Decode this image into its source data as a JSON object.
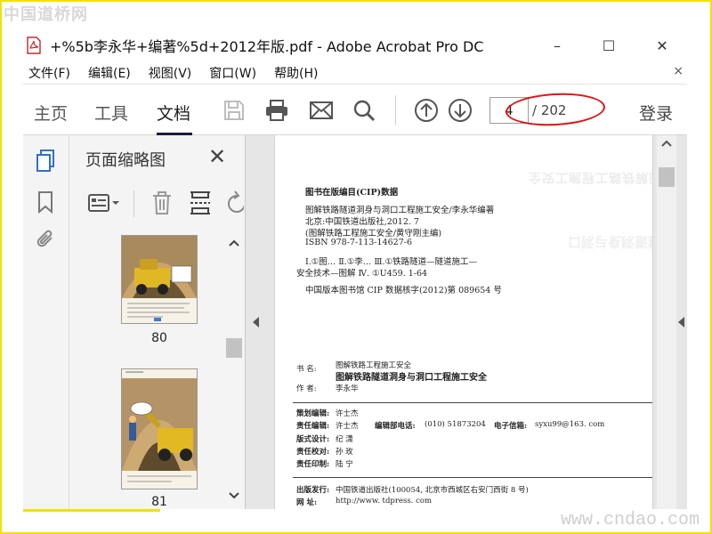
{
  "watermarks": {
    "top": "中国道桥网",
    "bottom": "www.cndao.com"
  },
  "window": {
    "title": "+%5b李永华+编著%5d+2012年版.pdf - Adobe Acrobat Pro DC",
    "controls": {
      "minimize": "–",
      "maximize": "☐",
      "close": "✕"
    }
  },
  "menu": {
    "items": [
      "文件(F)",
      "编辑(E)",
      "视图(V)",
      "窗口(W)",
      "帮助(H)"
    ],
    "close": "×"
  },
  "toolbar": {
    "tabs": [
      "主页",
      "工具",
      "文档"
    ],
    "active_tab": "文档",
    "page_number": "4",
    "page_total": "/ 202",
    "login": "登录",
    "icons": [
      "save-icon",
      "print-icon",
      "mail-icon",
      "search-icon",
      "page-up-icon",
      "page-down-icon"
    ]
  },
  "thumbnail_panel": {
    "title": "页面缩略图",
    "close": "✕",
    "pages": [
      {
        "label": "80"
      },
      {
        "label": "81"
      }
    ]
  },
  "document": {
    "cip_heading": "图书在版编目(CIP)数据",
    "cip_lines": [
      "图解铁路隧道洞身与洞口工程施工安全/李永华编著",
      "北京:中国铁道出版社,2012. 7",
      "(图解铁路工程施工安全/黄守刚主编)",
      "ISBN 978-7-113-14627-6"
    ],
    "classification_lines": [
      "Ⅰ.①图…  Ⅱ.①李…  Ⅲ.①铁路隧道—隧道施工—",
      "安全技术—图解  Ⅳ. ①U459. 1-64"
    ],
    "cip_record": "中国版本图书馆 CIP 数据核字(2012)第 089654 号",
    "book_label": "书    名:",
    "series_name": "图解铁路工程施工安全",
    "book_title": "图解铁路隧道洞身与洞口工程施工安全",
    "author_label": "作    者:",
    "author": "李永华",
    "planning_editor_label": "策划编辑:",
    "planning_editor": "许士杰",
    "responsible_editor_label": "责任编辑:",
    "responsible_editor": "许士杰",
    "editor_phone_label": "编辑部电话:",
    "editor_phone": "(010) 51873204",
    "email_label": "电子信箱:",
    "email": "syxu99@163. com",
    "design_label": "版式设计:",
    "design": "纪  潇",
    "proof_label": "责任校对:",
    "proof": "孙  玫",
    "print_label": "责任印制:",
    "print": "陆  宁",
    "publisher_label": "出版发行:",
    "publisher": "中国铁道出版社(100054, 北京市西城区右安门西街 8 号)",
    "url_label": "网      址:",
    "url": "http://www. tdpress. com",
    "ghost_text_1": "图解铁路工程施工安全",
    "ghost_text_2": "隧道洞身与洞口"
  },
  "colors": {
    "frame": "#f1e200",
    "annotation_oval": "#e01010",
    "active_tab_underline": "#1a1a40",
    "thumbnail_highlight": "#3a7bd5"
  }
}
